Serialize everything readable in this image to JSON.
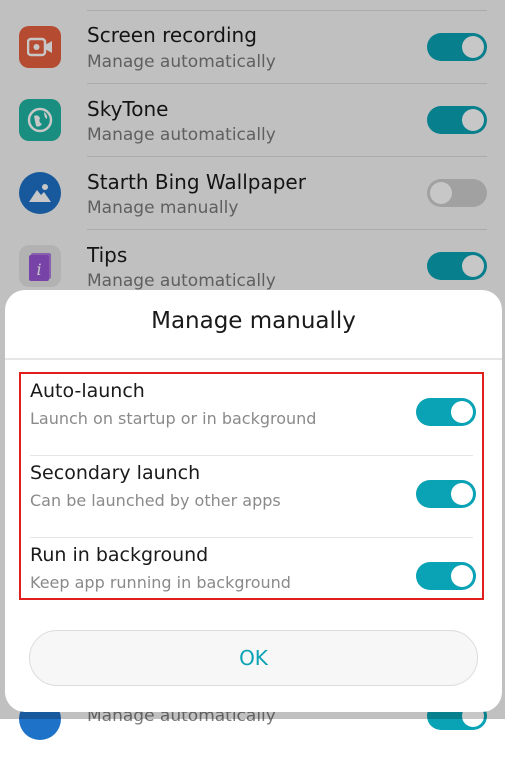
{
  "apps": [
    {
      "name": "Screen recording",
      "mode": "Manage automatically",
      "toggle_on": true,
      "icon": "video-camera-icon",
      "icon_color": "#e8613e"
    },
    {
      "name": "SkyTone",
      "mode": "Manage automatically",
      "toggle_on": true,
      "icon": "globe-icon",
      "icon_color": "#1fb5a5"
    },
    {
      "name": "Starth Bing Wallpaper",
      "mode": "Manage manually",
      "toggle_on": false,
      "icon": "mountain-icon",
      "icon_color": "#1e72c8"
    },
    {
      "name": "Tips",
      "mode": "Manage automatically",
      "toggle_on": true,
      "icon": "info-book-icon",
      "icon_color": "#9a57d6"
    },
    {
      "name": "",
      "mode": "Manage automatically",
      "toggle_on": true,
      "icon": "app-icon",
      "icon_color": "#1e72c8"
    }
  ],
  "dialog": {
    "title": "Manage manually",
    "options": [
      {
        "label": "Auto-launch",
        "description": "Launch on startup or in background",
        "enabled": true
      },
      {
        "label": "Secondary launch",
        "description": "Can be launched by other apps",
        "enabled": true
      },
      {
        "label": "Run in background",
        "description": "Keep app running in background",
        "enabled": true
      }
    ],
    "ok_label": "OK"
  },
  "colors": {
    "accent": "#0aa3b5",
    "highlight_border": "#e01e1e"
  }
}
